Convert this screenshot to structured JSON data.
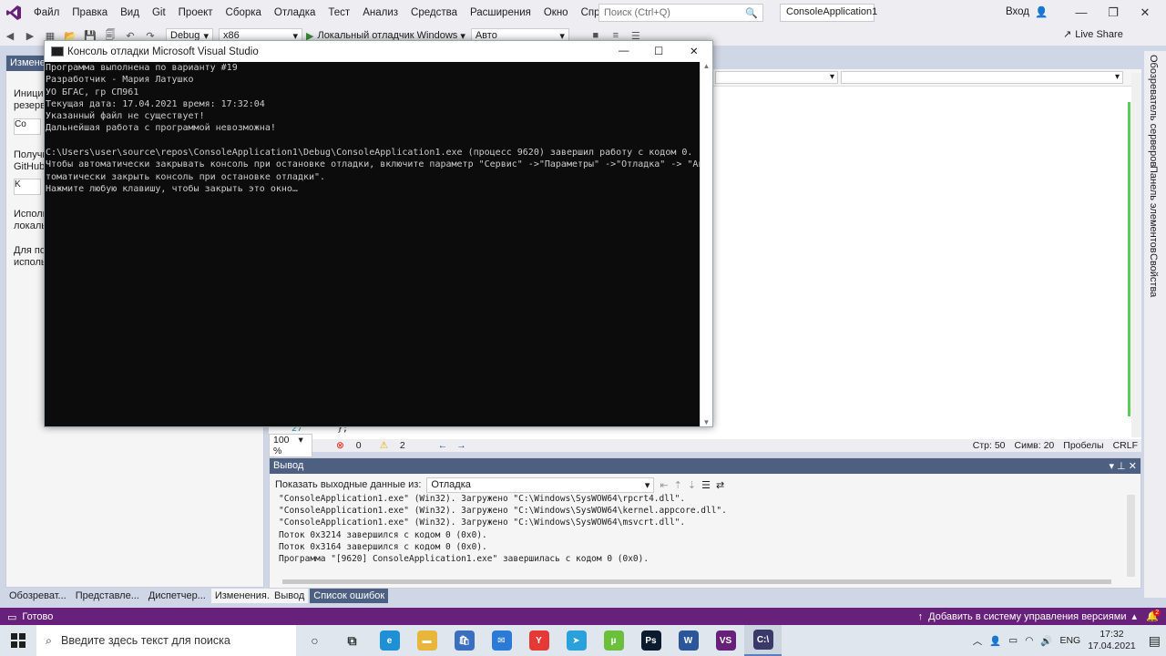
{
  "menu": [
    "Файл",
    "Правка",
    "Вид",
    "Git",
    "Проект",
    "Сборка",
    "Отладка",
    "Тест",
    "Анализ",
    "Средства",
    "Расширения",
    "Окно",
    "Справка"
  ],
  "search": {
    "placeholder": "Поиск (Ctrl+Q)"
  },
  "solution_name": "ConsoleApplication1",
  "signin_label": "Вход",
  "toolbar": {
    "config": "Debug",
    "platform": "x86",
    "run_label": "Локальный отладчик Windows",
    "auto": "Авто",
    "live_share": "Live Share"
  },
  "left_panel": {
    "title": "Изменен",
    "lines": [
      "Иници",
      "резерв",
      "Получи",
      "GitHub",
      "Исполь",
      "локаль",
      "Для пол",
      "исполь"
    ],
    "btn1": "Co",
    "btn2": "K"
  },
  "editor": {
    "line_number": "27",
    "line_text": "};",
    "zoom": "100 %",
    "errors": "0",
    "warnings": "2",
    "row": "Стр: 50",
    "col": "Симв: 20",
    "spaces": "Пробелы",
    "eol": "CRLF"
  },
  "right_tabs": [
    "Обозреватель серверов",
    "Панель элементов",
    "Свойства"
  ],
  "output": {
    "title": "Вывод",
    "show_label": "Показать выходные данные из:",
    "source": "Отладка",
    "lines": [
      "\"ConsoleApplication1.exe\" (Win32). Загружено \"C:\\Windows\\SysWOW64\\rpcrt4.dll\".",
      "\"ConsoleApplication1.exe\" (Win32). Загружено \"C:\\Windows\\SysWOW64\\kernel.appcore.dll\".",
      "\"ConsoleApplication1.exe\" (Win32). Загружено \"C:\\Windows\\SysWOW64\\msvcrt.dll\".",
      "Поток 0x3214 завершился с кодом 0 (0x0).",
      "Поток 0x3164 завершился с кодом 0 (0x0).",
      "Программа \"[9620] ConsoleApplication1.exe\" завершилась с кодом 0 (0x0)."
    ]
  },
  "left_bottom_tabs": [
    "Обозреват...",
    "Представле...",
    "Диспетчер...",
    "Изменения..."
  ],
  "output_bottom_tabs": [
    "Вывод",
    "Список ошибок"
  ],
  "status": {
    "ready": "Готово",
    "source_control": "Добавить в систему управления версиями",
    "notifications": "2"
  },
  "console": {
    "title": "Консоль отладки Microsoft Visual Studio",
    "lines": [
      "Программа выполнена по варианту #19",
      "Разработчик - Мария Латушко",
      "УО БГАС, гр СП961",
      "Текущая дата: 17.04.2021 время: 17:32:04",
      "Указанный файл не существует!",
      "Дальнейшая работа с программой невозможна!",
      "",
      "C:\\Users\\user\\source\\repos\\ConsoleApplication1\\Debug\\ConsoleApplication1.exe (процесс 9620) завершил работу с кодом 0.",
      "Чтобы автоматически закрывать консоль при остановке отладки, включите параметр \"Сервис\" ->\"Параметры\" ->\"Отладка\" -> \"Ав",
      "томатически закрыть консоль при остановке отладки\".",
      "Нажмите любую клавишу, чтобы закрыть это окно…"
    ]
  },
  "taskbar": {
    "search_placeholder": "Введите здесь текст для поиска",
    "apps": [
      {
        "name": "cortana",
        "label": "○",
        "color": "#333333"
      },
      {
        "name": "taskview",
        "label": "⧉",
        "color": "#333333"
      },
      {
        "name": "edge",
        "label": "e",
        "color": "#1f8fd6"
      },
      {
        "name": "explorer",
        "label": "▬",
        "color": "#e8b63b"
      },
      {
        "name": "store",
        "label": "🛍",
        "color": "#3a6fc0"
      },
      {
        "name": "mail",
        "label": "✉",
        "color": "#2b7bd6"
      },
      {
        "name": "yandex",
        "label": "Y",
        "color": "#e53935"
      },
      {
        "name": "telegram",
        "label": "➤",
        "color": "#2aa1da"
      },
      {
        "name": "utorrent",
        "label": "µ",
        "color": "#6cbf3a"
      },
      {
        "name": "photoshop",
        "label": "Ps",
        "color": "#0b1a2f"
      },
      {
        "name": "word",
        "label": "W",
        "color": "#2b579a"
      },
      {
        "name": "visualstudio",
        "label": "VS",
        "color": "#68217a"
      },
      {
        "name": "console",
        "label": "C:\\",
        "color": "#3a3a6a"
      }
    ],
    "lang": "ENG",
    "time": "17:32",
    "date": "17.04.2021"
  }
}
